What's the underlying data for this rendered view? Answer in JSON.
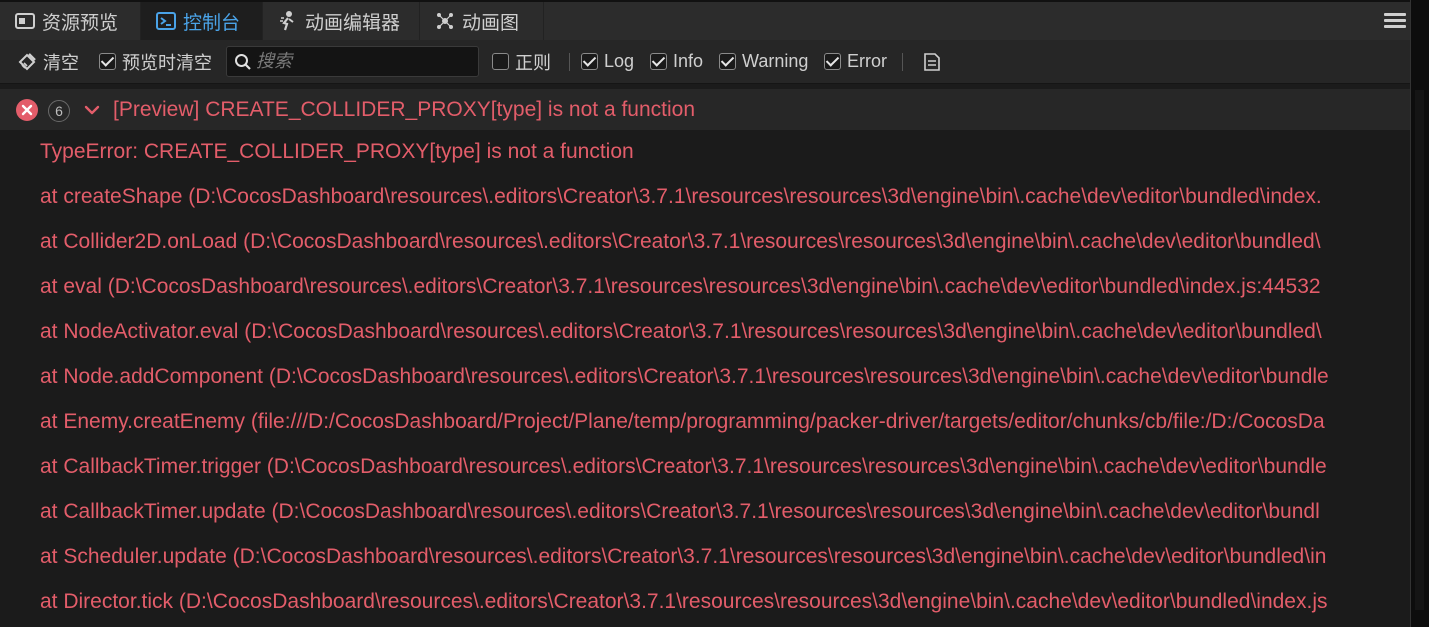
{
  "tabs": [
    {
      "label": "资源预览",
      "icon": "asset-preview-icon",
      "active": false
    },
    {
      "label": "控制台",
      "icon": "console-icon",
      "active": true
    },
    {
      "label": "动画编辑器",
      "icon": "animation-editor-icon",
      "active": false
    },
    {
      "label": "动画图",
      "icon": "animation-graph-icon",
      "active": false
    }
  ],
  "toolbar": {
    "clear_label": "清空",
    "clear_on_preview_label": "预览时清空",
    "clear_on_preview_checked": true,
    "search_placeholder": "搜索",
    "regex_label": "正则",
    "regex_checked": false,
    "filters": [
      {
        "label": "Log",
        "checked": true
      },
      {
        "label": "Info",
        "checked": true
      },
      {
        "label": "Warning",
        "checked": true
      },
      {
        "label": "Error",
        "checked": true
      }
    ]
  },
  "log_entry": {
    "count": "6",
    "message": "[Preview] CREATE_COLLIDER_PROXY[type] is not a function",
    "stack": [
      "TypeError: CREATE_COLLIDER_PROXY[type] is not a function",
      "at createShape (D:\\CocosDashboard\\resources\\.editors\\Creator\\3.7.1\\resources\\resources\\3d\\engine\\bin\\.cache\\dev\\editor\\bundled\\index.",
      "at Collider2D.onLoad (D:\\CocosDashboard\\resources\\.editors\\Creator\\3.7.1\\resources\\resources\\3d\\engine\\bin\\.cache\\dev\\editor\\bundled\\",
      "at eval (D:\\CocosDashboard\\resources\\.editors\\Creator\\3.7.1\\resources\\resources\\3d\\engine\\bin\\.cache\\dev\\editor\\bundled\\index.js:44532",
      "at NodeActivator.eval (D:\\CocosDashboard\\resources\\.editors\\Creator\\3.7.1\\resources\\resources\\3d\\engine\\bin\\.cache\\dev\\editor\\bundled\\",
      "at Node.addComponent (D:\\CocosDashboard\\resources\\.editors\\Creator\\3.7.1\\resources\\resources\\3d\\engine\\bin\\.cache\\dev\\editor\\bundle",
      "at Enemy.creatEnemy (file:///D:/CocosDashboard/Project/Plane/temp/programming/packer-driver/targets/editor/chunks/cb/file:/D:/CocosDa",
      "at CallbackTimer.trigger (D:\\CocosDashboard\\resources\\.editors\\Creator\\3.7.1\\resources\\resources\\3d\\engine\\bin\\.cache\\dev\\editor\\bundle",
      "at CallbackTimer.update (D:\\CocosDashboard\\resources\\.editors\\Creator\\3.7.1\\resources\\resources\\3d\\engine\\bin\\.cache\\dev\\editor\\bundl",
      "at Scheduler.update (D:\\CocosDashboard\\resources\\.editors\\Creator\\3.7.1\\resources\\resources\\3d\\engine\\bin\\.cache\\dev\\editor\\bundled\\in",
      "at Director.tick (D:\\CocosDashboard\\resources\\.editors\\Creator\\3.7.1\\resources\\resources\\3d\\engine\\bin\\.cache\\dev\\editor\\bundled\\index.js"
    ]
  },
  "colors": {
    "error_text": "#e35d6a",
    "active_tab_text": "#4aa3e8",
    "background": "#1b1b1b"
  }
}
